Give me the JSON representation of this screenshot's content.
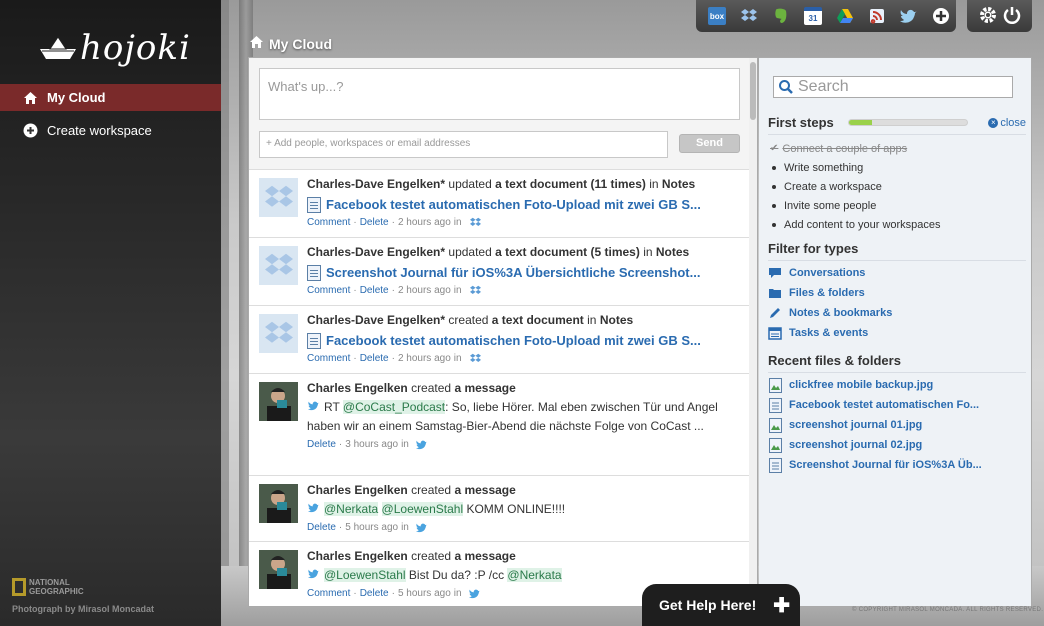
{
  "app": {
    "logo_text": "hojoki"
  },
  "sidebar": {
    "items": [
      {
        "label": "My Cloud",
        "icon": "home-icon",
        "active": true
      },
      {
        "label": "Create workspace",
        "icon": "plus-circle-icon",
        "active": false
      }
    ],
    "brand": {
      "line1": "NATIONAL",
      "line2": "GEOGRAPHIC"
    },
    "photo_credit": "Photograph by Mirasol Moncadat"
  },
  "toolbar": {
    "services": [
      "box-icon",
      "dropbox-icon",
      "evernote-icon",
      "google-calendar-icon",
      "google-drive-icon",
      "rss-icon",
      "twitter-icon",
      "add-service-icon"
    ],
    "calendar_number": "31",
    "box_label": "box",
    "settings_icon": "gear-icon",
    "power_icon": "power-icon"
  },
  "page": {
    "title": "My Cloud"
  },
  "composer": {
    "placeholder": "What's up...?",
    "add_people_placeholder": "+ Add people, workspaces or email addresses",
    "send_label": "Send"
  },
  "feed": [
    {
      "type": "doc",
      "author": "Charles-Dave Engelken*",
      "verb": "updated",
      "object": "a text document",
      "extra": "(11 times)",
      "in": "in",
      "target": "Notes",
      "title": "Facebook testet automatischen Foto-Upload mit zwei GB S...",
      "actions": [
        "Comment",
        "Delete"
      ],
      "time": "2 hours ago",
      "service": "dropbox-icon"
    },
    {
      "type": "doc",
      "author": "Charles-Dave Engelken*",
      "verb": "updated",
      "object": "a text document",
      "extra": "(5 times)",
      "in": "in",
      "target": "Notes",
      "title": "Screenshot Journal für iOS%3A Übersichtliche Screenshot...",
      "actions": [
        "Comment",
        "Delete"
      ],
      "time": "2 hours ago",
      "service": "dropbox-icon"
    },
    {
      "type": "doc",
      "author": "Charles-Dave Engelken*",
      "verb": "created",
      "object": "a text document",
      "extra": "",
      "in": "in",
      "target": "Notes",
      "title": "Facebook testet automatischen Foto-Upload mit zwei GB S...",
      "actions": [
        "Comment",
        "Delete"
      ],
      "time": "2 hours ago",
      "service": "dropbox-icon"
    },
    {
      "type": "msg",
      "author": "Charles Engelken",
      "verb": "created",
      "object": "a message",
      "pre": "RT ",
      "mention1": "@CoCast_Podcast",
      "text": ": So, liebe Hörer. Mal eben zwischen Tür und Angel haben wir an einem Samstag-Bier-Abend die nächste Folge von CoCast ...",
      "actions": [
        "Delete"
      ],
      "time": "3 hours ago",
      "service": "twitter-icon"
    },
    {
      "type": "msg",
      "author": "Charles Engelken",
      "verb": "created",
      "object": "a message",
      "mention1": "@Nerkata",
      "mention2": "@LoewenStahl",
      "text": " KOMM ONLINE!!!!",
      "actions": [
        "Delete"
      ],
      "time": "5 hours ago",
      "service": "twitter-icon"
    },
    {
      "type": "msg",
      "author": "Charles Engelken",
      "verb": "created",
      "object": "a message",
      "mention1": "@LoewenStahl",
      "text": " Bist Du da? :P /cc ",
      "mention2": "@Nerkata",
      "actions": [
        "Comment",
        "Delete"
      ],
      "time": "5 hours ago",
      "service": "twitter-icon"
    }
  ],
  "right": {
    "search_placeholder": "Search",
    "first_steps": {
      "title": "First steps",
      "progress": 0.2,
      "close_label": "close",
      "steps": [
        {
          "label": "Connect a couple of apps",
          "done": true
        },
        {
          "label": "Write something",
          "done": false
        },
        {
          "label": "Create a workspace",
          "done": false
        },
        {
          "label": "Invite some people",
          "done": false
        },
        {
          "label": "Add content to your workspaces",
          "done": false
        }
      ]
    },
    "filter": {
      "title": "Filter for types",
      "items": [
        {
          "label": "Conversations",
          "icon": "speech-bubble-icon"
        },
        {
          "label": "Files & folders",
          "icon": "folder-icon"
        },
        {
          "label": "Notes & bookmarks",
          "icon": "pencil-icon"
        },
        {
          "label": "Tasks & events",
          "icon": "calendar-icon"
        }
      ]
    },
    "recent": {
      "title": "Recent files & folders",
      "items": [
        {
          "label": "clickfree mobile backup.jpg",
          "icon": "image-file-icon"
        },
        {
          "label": "Facebook testet automatischen Fo...",
          "icon": "document-icon"
        },
        {
          "label": "screenshot journal 01.jpg",
          "icon": "image-file-icon"
        },
        {
          "label": "screenshot journal 02.jpg",
          "icon": "image-file-icon"
        },
        {
          "label": "Screenshot Journal für iOS%3A Üb...",
          "icon": "document-icon"
        }
      ]
    }
  },
  "help": {
    "label": "Get Help Here!",
    "icon": "plus-icon"
  },
  "copyright": "© COPYRIGHT MIRASOL MONCADA. ALL RIGHTS RESERVED.",
  "colors": {
    "accent": "#2a6bb0",
    "active_nav": "#7a2a2a",
    "progress": "#9ad14a"
  }
}
